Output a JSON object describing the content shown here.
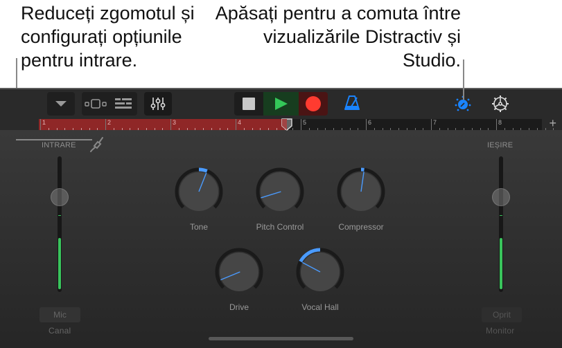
{
  "callouts": {
    "left": "Reduceți zgomotul și configurați opțiunile pentru intrare.",
    "right": "Apăsați pentru a comuta între vizualizările Distractiv și Studio."
  },
  "toolbar": {
    "icons": {
      "browser": "dropdown-triangle-icon",
      "tracks_view": "tracks-view-icon",
      "multitrack": "multitrack-list-icon",
      "mixer": "mixer-sliders-icon",
      "stop": "stop-icon",
      "play": "play-icon",
      "record": "record-icon",
      "metronome": "metronome-icon",
      "view_toggle": "knob-view-toggle-icon",
      "settings": "gear-icon"
    },
    "colors": {
      "accent": "#1a84ff",
      "play": "#34c759",
      "record": "#ff3b30",
      "cycle_region": "#8f2727"
    }
  },
  "ruler": {
    "bars": [
      "1",
      "2",
      "3",
      "4",
      "5",
      "6",
      "7",
      "8"
    ],
    "add_label": "+"
  },
  "input": {
    "title": "INTRARE",
    "channel_button": "Mic",
    "channel_label": "Canal",
    "level_fraction": 0.38,
    "fader_fraction": 0.7
  },
  "output": {
    "title": "IEȘIRE",
    "monitor_button": "Oprit",
    "monitor_label": "Monitor",
    "level_fraction": 0.38,
    "fader_fraction": 0.7
  },
  "knobs": [
    {
      "name": "Tone",
      "value": 0.58
    },
    {
      "name": "Pitch Control",
      "value": 0.1
    },
    {
      "name": "Compressor",
      "value": 0.53
    },
    {
      "name": "Drive",
      "value": 0.08
    },
    {
      "name": "Vocal Hall",
      "value": 0.27
    }
  ]
}
